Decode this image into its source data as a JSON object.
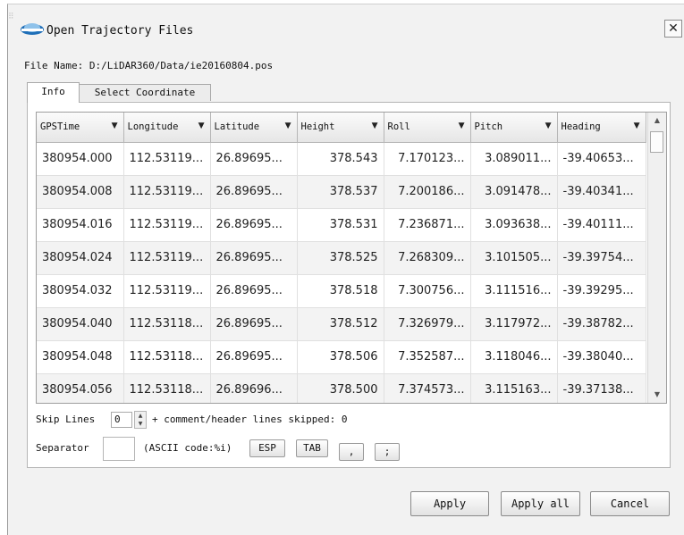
{
  "window": {
    "title": "Open Trajectory Files",
    "close_symbol": "✕",
    "ghost_icon": "⠿"
  },
  "file": {
    "label": "File Name: D:/LiDAR360/Data/ie20160804.pos"
  },
  "tabs": [
    {
      "label": "Info",
      "active": true
    },
    {
      "label": "Select Coordinate",
      "active": false
    }
  ],
  "table": {
    "columns": [
      "GPSTime",
      "Longitude",
      "Latitude",
      "Height",
      "Roll",
      "Pitch",
      "Heading"
    ],
    "dropdown_glyph": "▼",
    "rows": [
      [
        "380954.000",
        "112.53119...",
        "26.89695...",
        "378.543",
        "7.170123...",
        "3.089011...",
        "-39.40653..."
      ],
      [
        "380954.008",
        "112.53119...",
        "26.89695...",
        "378.537",
        "7.200186...",
        "3.091478...",
        "-39.40341..."
      ],
      [
        "380954.016",
        "112.53119...",
        "26.89695...",
        "378.531",
        "7.236871...",
        "3.093638...",
        "-39.40111..."
      ],
      [
        "380954.024",
        "112.53119...",
        "26.89695...",
        "378.525",
        "7.268309...",
        "3.101505...",
        "-39.39754..."
      ],
      [
        "380954.032",
        "112.53119...",
        "26.89695...",
        "378.518",
        "7.300756...",
        "3.111516...",
        "-39.39295..."
      ],
      [
        "380954.040",
        "112.53118...",
        "26.89695...",
        "378.512",
        "7.326979...",
        "3.117972...",
        "-39.38782..."
      ],
      [
        "380954.048",
        "112.53118...",
        "26.89695...",
        "378.506",
        "7.352587...",
        "3.118046...",
        "-39.38040..."
      ],
      [
        "380954.056",
        "112.53118...",
        "26.89696...",
        "378.500",
        "7.374573...",
        "3.115163...",
        "-39.37138..."
      ]
    ],
    "scroll_up": "▲",
    "scroll_down": "▼"
  },
  "skip": {
    "label": "Skip Lines",
    "value": "0",
    "suffix": "+ comment/header lines skipped: 0",
    "spin_up": "▲",
    "spin_down": "▼"
  },
  "separator": {
    "label": "Separator",
    "value": "",
    "ascii_label": "(ASCII code:%i)",
    "buttons": [
      "ESP",
      "TAB",
      ",",
      ";"
    ]
  },
  "actions": {
    "apply": "Apply",
    "apply_all": "Apply all",
    "cancel": "Cancel"
  },
  "colors": {
    "dialog_bg": "#f2f2f2",
    "logo_blue": "#1f6fb8",
    "grid_border": "#9e9e9e"
  }
}
